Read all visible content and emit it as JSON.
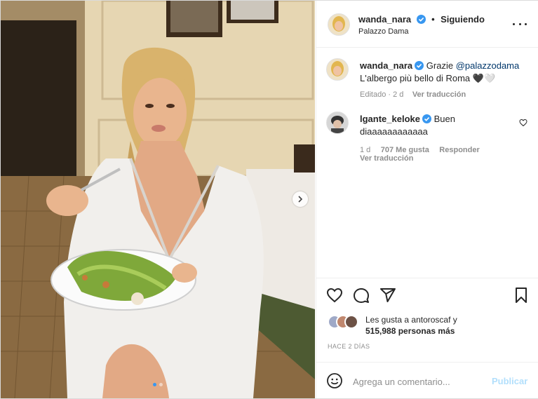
{
  "post": {
    "username": "wanda_nara",
    "follow_status": "Siguiendo",
    "separator": "•",
    "location": "Palazzo Dama"
  },
  "caption": {
    "username": "wanda_nara",
    "text": "Grazie",
    "mention": "@palazzodama",
    "line2": "L'albergo più bello di Roma",
    "line2_emojis": "🖤🤍",
    "meta_edited": "Editado · 2 d",
    "meta_translate": "Ver traducción"
  },
  "comment": {
    "username": "lgante_keloke",
    "text_start": "Buen",
    "text_line2": "diaaaaaaaaaaaa",
    "time": "1 d",
    "likes": "707 Me gusta",
    "reply": "Responder",
    "translate": "Ver traducción"
  },
  "likes": {
    "prefix": "Les gusta a",
    "user": "antoroscaf",
    "suffix": "y",
    "count_text": "515,988 personas más"
  },
  "timestamp": "HACE 2 DÍAS",
  "comment_box": {
    "placeholder": "Agrega un comentario...",
    "publish": "Publicar"
  },
  "carousel": {
    "slides": 2,
    "current": 1
  },
  "colors": {
    "accent": "#3897f0",
    "verified": "#3897f0",
    "publish_disabled": "#b2dffc"
  },
  "icons": [
    "more-icon",
    "verified-icon",
    "heart-icon",
    "comment-icon",
    "share-icon",
    "bookmark-icon",
    "emoji-icon",
    "chevron-right-icon"
  ]
}
